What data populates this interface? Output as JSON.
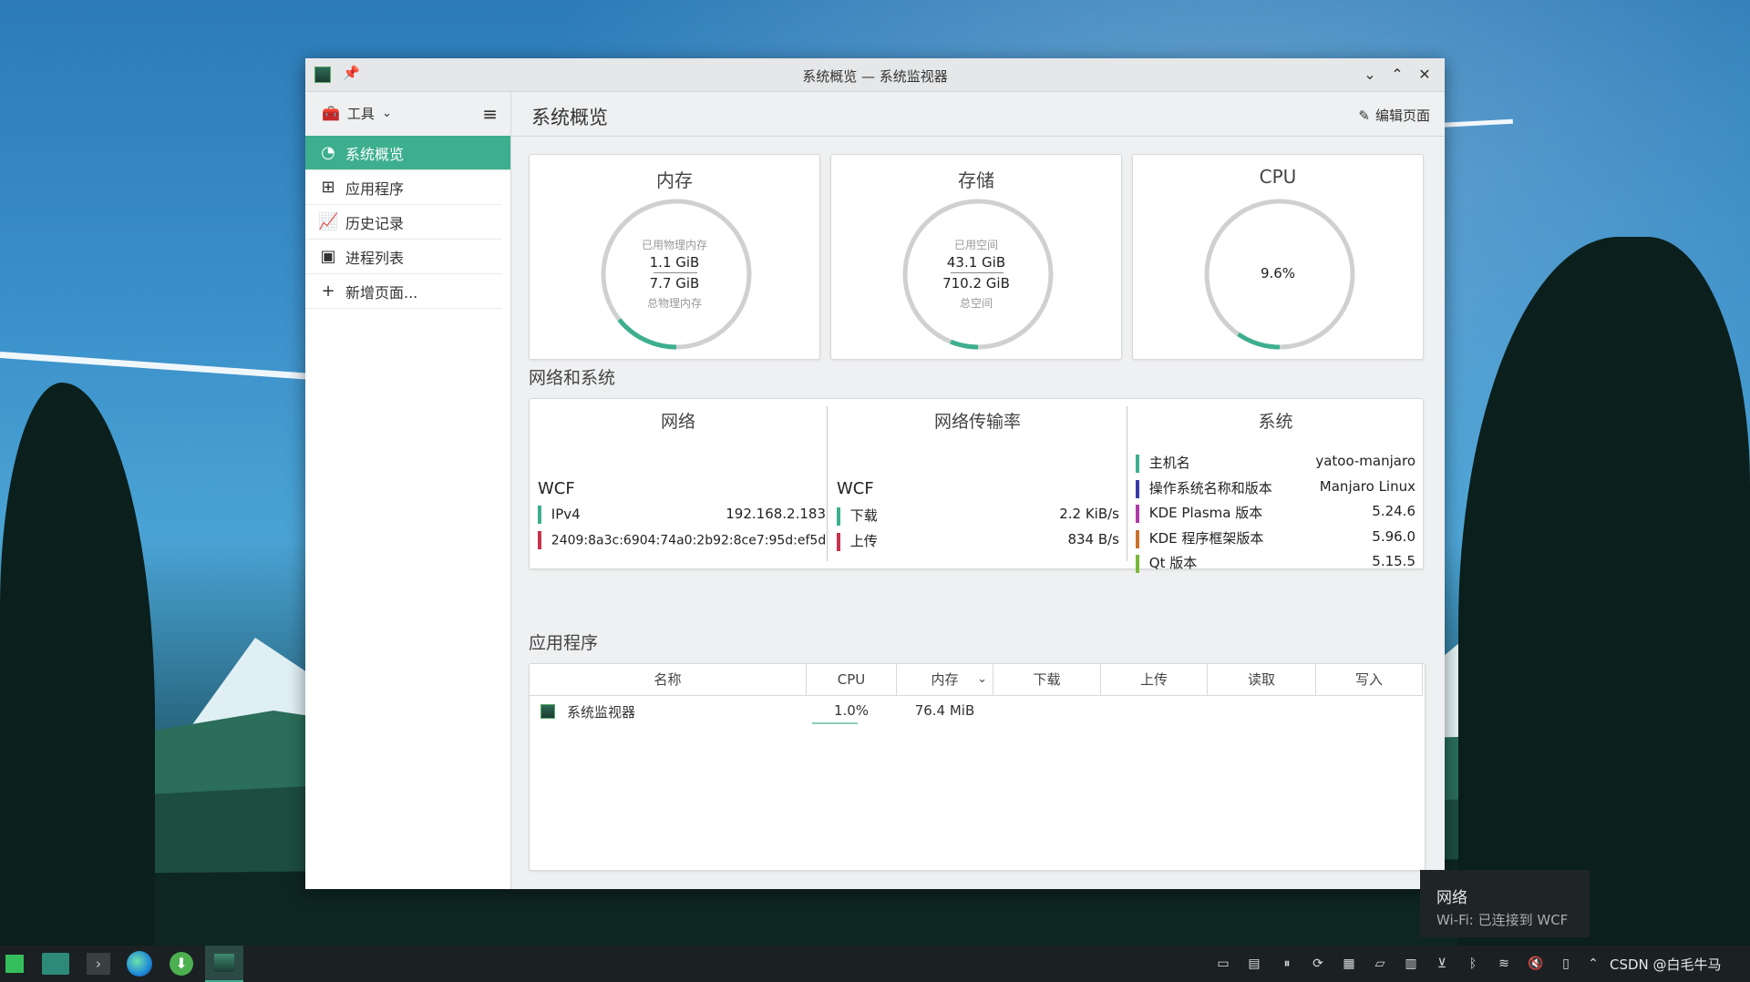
{
  "window": {
    "title": "系统概览 — 系统监视器"
  },
  "sidebar": {
    "tools_label": "工具",
    "items": [
      {
        "label": "系统概览"
      },
      {
        "label": "应用程序"
      },
      {
        "label": "历史记录"
      },
      {
        "label": "进程列表"
      },
      {
        "label": "新增页面..."
      }
    ]
  },
  "header": {
    "title": "系统概览",
    "edit_label": "编辑页面"
  },
  "gauges": {
    "memory": {
      "title": "内存",
      "label_top": "已用物理内存",
      "used": "1.1 GiB",
      "total": "7.7 GiB",
      "label_bottom": "总物理内存",
      "fraction": 0.143
    },
    "storage": {
      "title": "存储",
      "label_top": "已用空间",
      "used": "43.1 GiB",
      "total": "710.2 GiB",
      "label_bottom": "总空间",
      "fraction": 0.061
    },
    "cpu": {
      "title": "CPU",
      "value": "9.6%",
      "fraction": 0.096
    }
  },
  "net_section": {
    "title": "网络和系统",
    "network": {
      "title": "网络",
      "iface": "WCF",
      "ipv4_label": "IPv4",
      "ipv4": "192.168.2.183",
      "ipv6": "2409:8a3c:6904:74a0:2b92:8ce7:95d:ef5d"
    },
    "rate": {
      "title": "网络传输率",
      "iface": "WCF",
      "down_label": "下载",
      "down": "2.2 KiB/s",
      "up_label": "上传",
      "up": "834 B/s"
    },
    "system": {
      "title": "系统",
      "rows": [
        {
          "label": "主机名",
          "value": "yatoo-manjaro",
          "color": "#3daf8e"
        },
        {
          "label": "操作系统名称和版本",
          "value": "Manjaro Linux",
          "color": "#3a3aa8"
        },
        {
          "label": "KDE Plasma 版本",
          "value": "5.24.6",
          "color": "#b03aa8"
        },
        {
          "label": "KDE 程序框架版本",
          "value": "5.96.0",
          "color": "#c8702a"
        },
        {
          "label": "Qt 版本",
          "value": "5.15.5",
          "color": "#7ab83a"
        }
      ]
    },
    "colors": {
      "ipv4": "#3daf8e",
      "ipv6": "#c8324a",
      "down": "#3daf8e",
      "up": "#c8324a"
    }
  },
  "apps": {
    "title": "应用程序",
    "columns": [
      "名称",
      "CPU",
      "内存",
      "下载",
      "上传",
      "读取",
      "写入"
    ],
    "rows": [
      {
        "name": "系统监视器",
        "cpu": "1.0%",
        "mem": "76.4 MiB",
        "cpu_fraction": 0.01
      }
    ]
  },
  "tooltip": {
    "title": "网络",
    "text": "Wi-Fi: 已连接到 WCF"
  },
  "taskbar": {
    "clock_text": "CSDN @白毛牛马"
  }
}
